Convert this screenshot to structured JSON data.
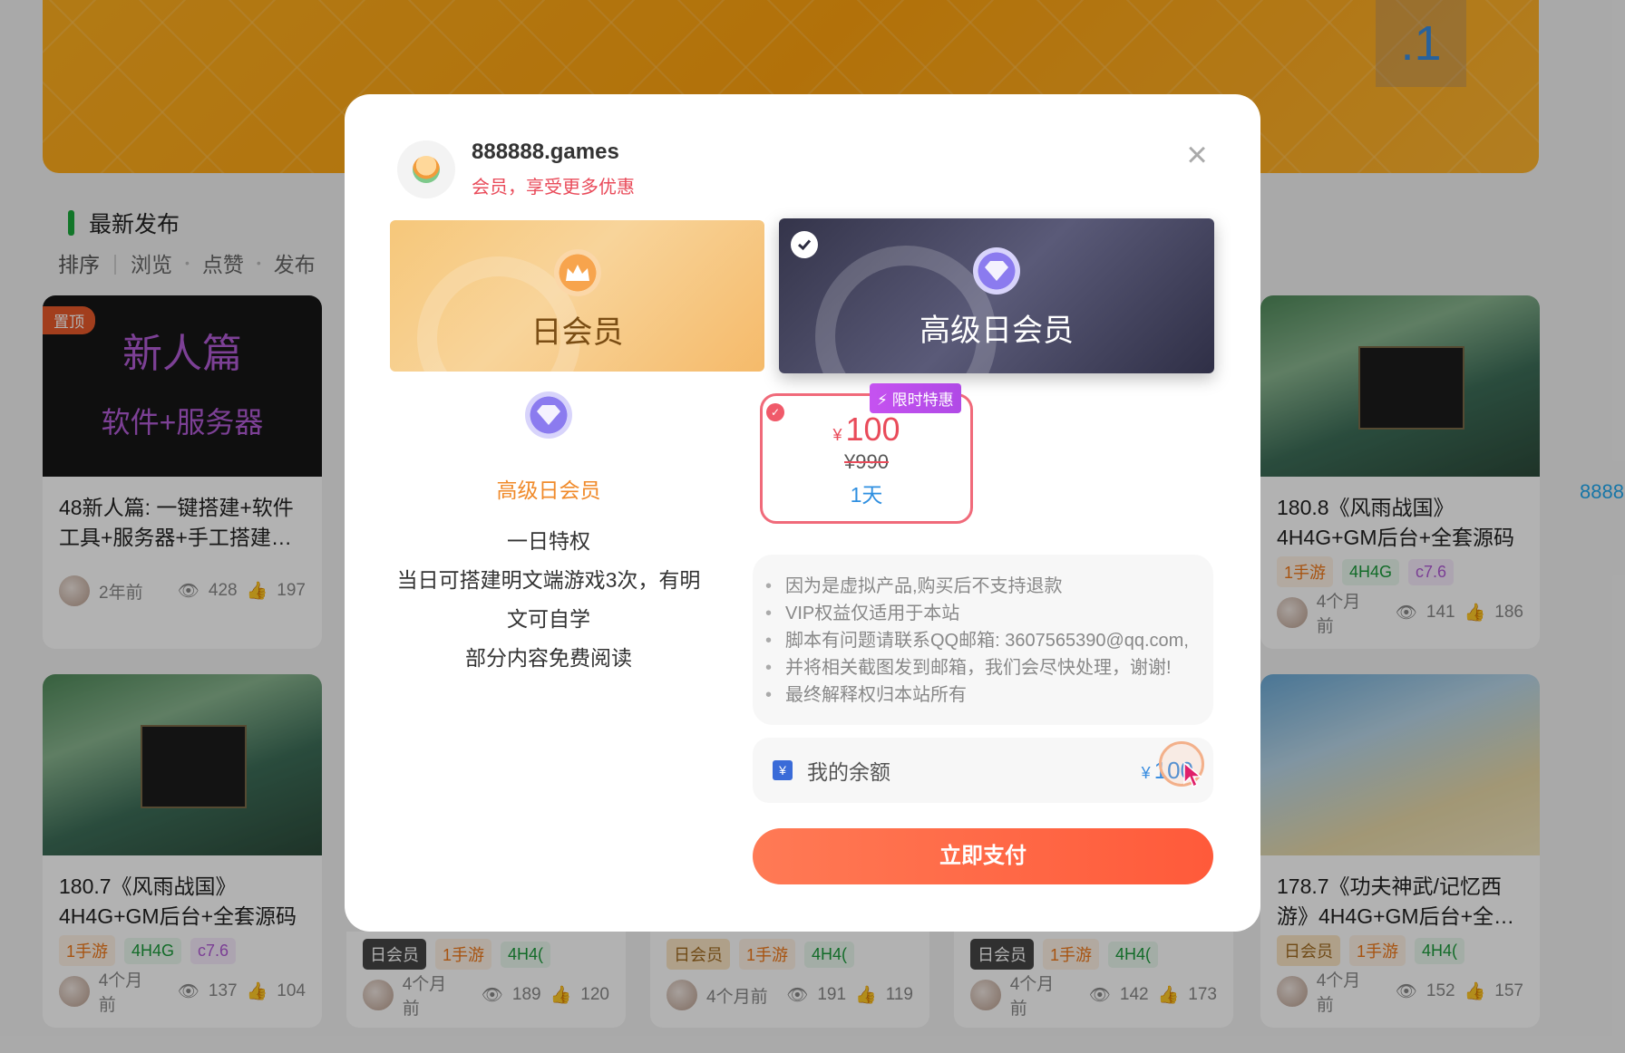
{
  "background": {
    "banner_text": ".1",
    "section_title": "最新发布",
    "sort": {
      "label": "排序",
      "options": [
        "浏览",
        "点赞",
        "发布"
      ]
    },
    "edge_text": "8888",
    "cards": [
      {
        "pin": "置顶",
        "thumb_title": "新人篇",
        "thumb_sub": "软件+服务器",
        "title": "48新人篇: 一键搭建+软件工具+服务器+手工搭建…",
        "tags": [],
        "time": "2年前",
        "views": "428",
        "likes": "197"
      },
      {
        "title": "180.8《风雨战国》4H4G+GM后台+全套源码",
        "tags": [
          "1手游",
          "4H4G",
          "c7.6"
        ],
        "time": "4个月前",
        "views": "141",
        "likes": "186"
      },
      {
        "title": "180.7《风雨战国》4H4G+GM后台+全套源码",
        "tags": [
          "1手游",
          "4H4G",
          "c7.6"
        ],
        "time": "4个月前",
        "views": "137",
        "likes": "104"
      },
      {
        "title": "178.7《功夫神武/记忆西游》4H4G+GM后台+全…",
        "tags": [
          "日会员",
          "1手游",
          "4H4("
        ],
        "time": "4个月前",
        "views": "152",
        "likes": "157"
      }
    ],
    "bottom_rows": [
      {
        "tags": [
          "日会员",
          "1手游",
          "4H4("
        ],
        "time": "4个月前",
        "views": "189",
        "likes": "120"
      },
      {
        "tags": [
          "日会员",
          "1手游",
          "4H4("
        ],
        "time": "4个月前",
        "views": "191",
        "likes": "119"
      },
      {
        "tags": [
          "日会员",
          "1手游",
          "4H4("
        ],
        "time": "4个月前",
        "views": "142",
        "likes": "173"
      }
    ]
  },
  "modal": {
    "user_name": "888888.games",
    "subtitle": "会员，享受更多优惠",
    "plans": [
      {
        "name": "日会员",
        "selected": false
      },
      {
        "name": "高级日会员",
        "selected": true
      }
    ],
    "benefit": {
      "name": "高级日会员",
      "lines": [
        "一日特权",
        "当日可搭建明文端游戏3次，有明",
        "文可自学",
        "部分内容免费阅读"
      ]
    },
    "price_option": {
      "badge": "限时特惠",
      "currency": "¥",
      "price": "100",
      "original": "¥990",
      "duration": "1天"
    },
    "notices": [
      "因为是虚拟产品,购买后不支持退款",
      "VIP权益仅适用于本站",
      "脚本有问题请联系QQ邮箱: 3607565390@qq.com,",
      "并将相关截图发到邮箱，我们会尽快处理，谢谢!",
      "最终解释权归本站所有"
    ],
    "balance": {
      "label": "我的余额",
      "currency": "¥",
      "value": "100"
    },
    "pay_button": "立即支付"
  }
}
